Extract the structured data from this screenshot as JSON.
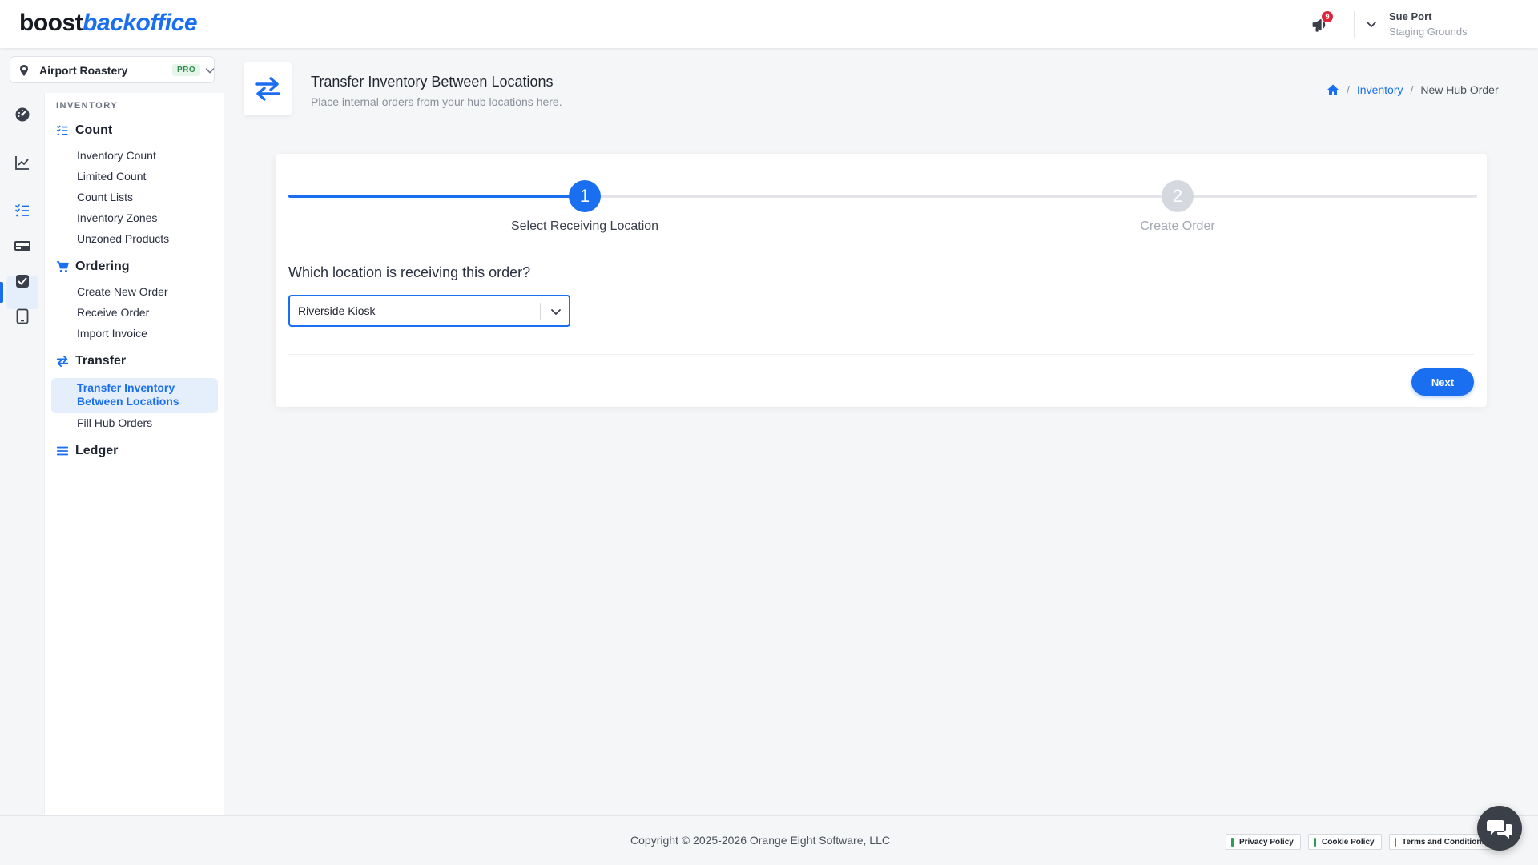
{
  "header": {
    "logo_part1": "boost",
    "logo_part2": "backoffice",
    "notification_count": "9",
    "user_name": "Sue Port",
    "user_location": "Staging Grounds"
  },
  "location_selector": {
    "name": "Airport Roastery",
    "badge": "PRO"
  },
  "rail": {
    "icons": [
      "dashboard-icon",
      "chart-line-icon",
      "checklist-icon",
      "register-icon",
      "checkbox-icon",
      "tablet-icon"
    ],
    "active": "checklist-icon"
  },
  "sidebar": {
    "section": "INVENTORY",
    "groups": [
      {
        "label": "Count",
        "icon": "checklist-icon",
        "items": [
          "Inventory Count",
          "Limited Count",
          "Count Lists",
          "Inventory Zones",
          "Unzoned Products"
        ]
      },
      {
        "label": "Ordering",
        "icon": "cart-icon",
        "items": [
          "Create New Order",
          "Receive Order",
          "Import Invoice"
        ]
      },
      {
        "label": "Transfer",
        "icon": "transfer-icon",
        "items": [
          "Transfer Inventory Between Locations",
          "Fill Hub Orders"
        ],
        "active": "Transfer Inventory Between Locations"
      },
      {
        "label": "Ledger",
        "icon": "list-icon",
        "items": []
      }
    ]
  },
  "page": {
    "title": "Transfer Inventory Between Locations",
    "subtitle": "Place internal orders from your hub locations here.",
    "breadcrumb": {
      "link": "Inventory",
      "current": "New Hub Order"
    }
  },
  "wizard": {
    "steps": [
      {
        "number": "1",
        "label": "Select Receiving Location",
        "state": "active"
      },
      {
        "number": "2",
        "label": "Create Order",
        "state": "pending"
      }
    ],
    "question": "Which location is receiving this order?",
    "selected_location": "Riverside Kiosk",
    "next_label": "Next"
  },
  "footer": {
    "copyright": "Copyright © 2025-2026 Orange Eight Software, LLC",
    "links": [
      "Privacy Policy",
      "Cookie Policy",
      "Terms and Conditions"
    ]
  },
  "colors": {
    "accent": "#1a6ff0",
    "badge_red": "#e0263c",
    "pro_green": "#2e8b4d"
  }
}
